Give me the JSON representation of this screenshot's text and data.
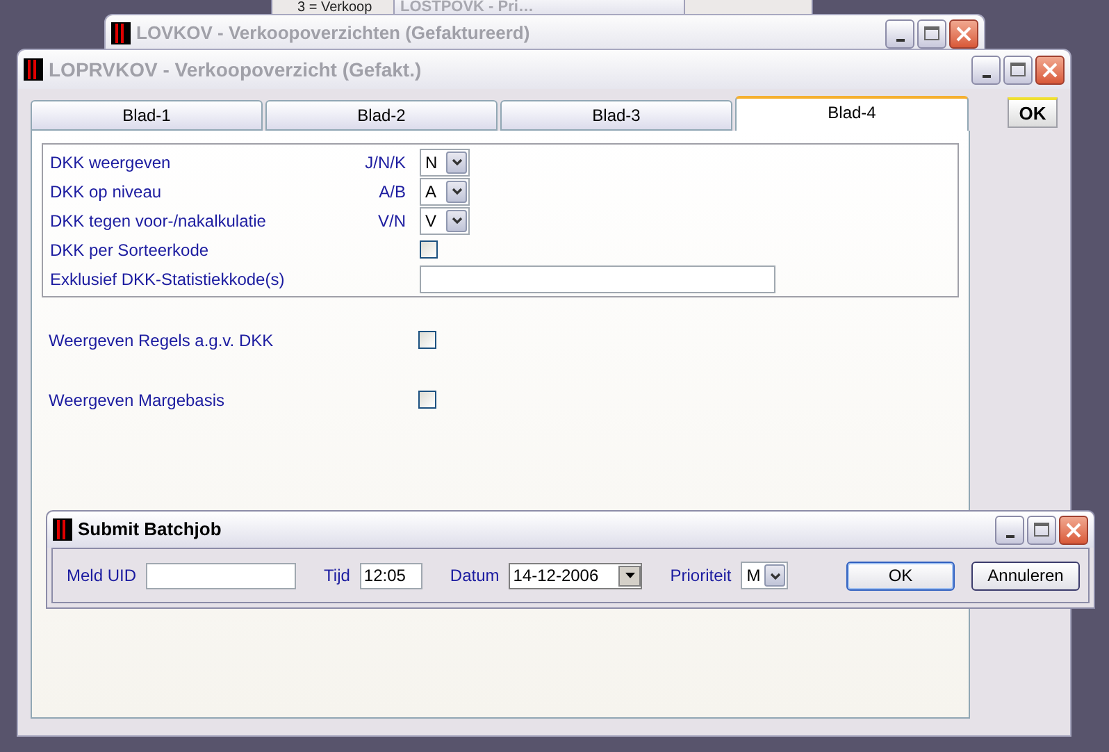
{
  "background_windows": [
    {
      "kind": "strip",
      "text": "3 = Verkoop"
    },
    {
      "kind": "titlebar",
      "title": "LOSTPOVK - Pri…"
    },
    {
      "kind": "window",
      "title": "LOVKOV - Verkoopoverzichten (Gefaktureerd)"
    }
  ],
  "main_window": {
    "title": "LOPRVKOV - Verkoopoverzicht (Gefakt.)",
    "tabs": [
      {
        "label": "Blad-1",
        "selected": false
      },
      {
        "label": "Blad-2",
        "selected": false
      },
      {
        "label": "Blad-3",
        "selected": false
      },
      {
        "label": "Blad-4",
        "selected": true
      }
    ],
    "ok_button": "OK",
    "group_rows": [
      {
        "kind": "select",
        "label": "DKK weergeven",
        "hint": "J/N/K",
        "value": "N"
      },
      {
        "kind": "select",
        "label": "DKK op niveau",
        "hint": "A/B",
        "value": "A"
      },
      {
        "kind": "select",
        "label": "DKK tegen voor-/nakalkulatie",
        "hint": "V/N",
        "value": "V"
      },
      {
        "kind": "checkbox",
        "label": "DKK per Sorteerkode",
        "checked": false
      },
      {
        "kind": "text",
        "label": "Exklusief DKK-Statistiekkode(s)"
      }
    ],
    "options": [
      {
        "label": "Weergeven Regels a.g.v. DKK",
        "checked": false
      },
      {
        "label": "Weergeven Margebasis",
        "checked": false
      }
    ]
  },
  "dialog": {
    "title": "Submit Batchjob",
    "fields": [
      {
        "kind": "text",
        "label": "Meld UID"
      },
      {
        "kind": "time",
        "label": "Tijd",
        "value": "12:05"
      },
      {
        "kind": "date",
        "label": "Datum",
        "value": "14-12-2006"
      },
      {
        "kind": "select",
        "label": "Prioriteit",
        "value": "M"
      }
    ],
    "buttons": [
      {
        "label": "OK",
        "default": true
      },
      {
        "label": "Annuleren",
        "default": false
      }
    ]
  }
}
